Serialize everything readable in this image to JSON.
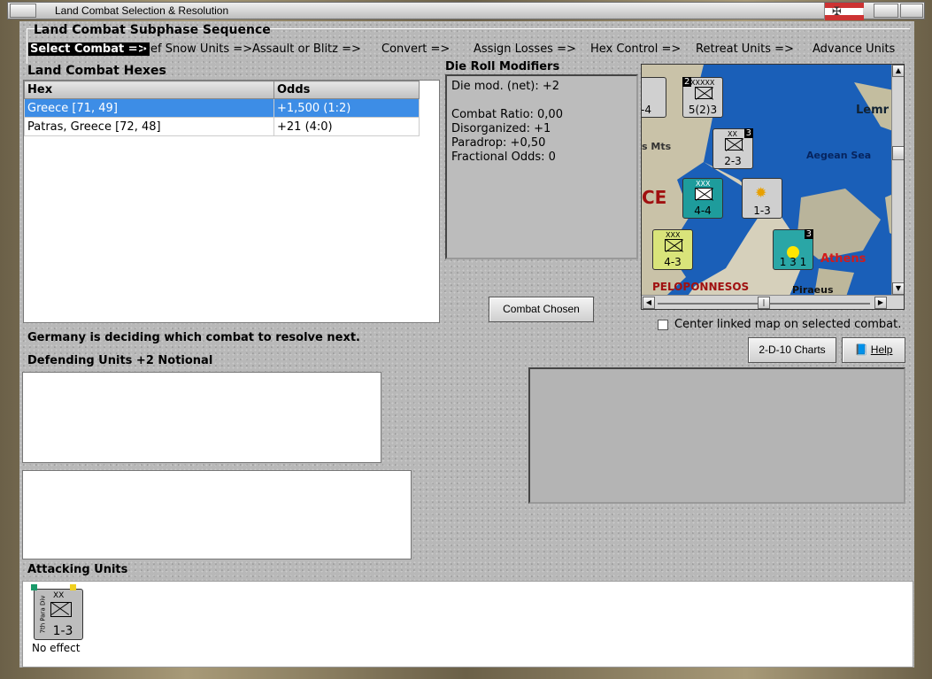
{
  "window": {
    "title": "Land Combat Selection & Resolution"
  },
  "sequence": {
    "title": "Land Combat Subphase Sequence",
    "items": [
      {
        "label": "Select Combat =>",
        "active": true
      },
      {
        "label": "Def Snow Units =>"
      },
      {
        "label": "Assault or Blitz =>"
      },
      {
        "label": "Convert =>"
      },
      {
        "label": "Assign Losses =>"
      },
      {
        "label": "Hex Control =>"
      },
      {
        "label": "Retreat Units =>"
      },
      {
        "label": "Advance Units"
      }
    ]
  },
  "hexes": {
    "title": "Land Combat Hexes",
    "columns": [
      "Hex",
      "Odds"
    ],
    "rows": [
      {
        "hex": "Greece [71, 49]",
        "odds": "+1,500 (1:2)",
        "selected": true
      },
      {
        "hex": "Patras, Greece [72, 48]",
        "odds": "+21 (4:0)"
      }
    ]
  },
  "modifiers": {
    "title": "Die Roll Modifiers",
    "net": "Die mod. (net): +2",
    "lines": [
      "Combat Ratio: 0,00",
      "Disorganized: +1",
      "Paradrop: +0,50",
      "Fractional Odds: 0"
    ]
  },
  "map": {
    "labels": {
      "lemnos": "Lemr",
      "aegean": "Aegean Sea",
      "mts": "s Mts",
      "ce": "CE",
      "athens": "Athens",
      "peloponnesos": "PELOPONNESOS",
      "piraeus": "Piraeus"
    },
    "counters": [
      {
        "strength": "-4"
      },
      {
        "strength": "5(2)3",
        "size": "XXXXX",
        "badge": "2"
      },
      {
        "strength": "2-3",
        "size": "XX",
        "badge": "3"
      },
      {
        "strength": "4-4",
        "size": "XXX"
      },
      {
        "strength": "1-3"
      },
      {
        "strength": "4-3",
        "size": "XXX"
      },
      {
        "strength": "1 3 1",
        "badge": "3"
      }
    ]
  },
  "combat_button": "Combat Chosen",
  "center_checkbox": {
    "label": "Center linked map on selected combat.",
    "checked": false
  },
  "status": "Germany is deciding which combat to resolve next.",
  "defending_title": "Defending Units +2 Notional",
  "charts_button": "2-D-10 Charts",
  "help_button": "Help",
  "attacking": {
    "title": "Attacking Units",
    "units": [
      {
        "label": "7th Para Div",
        "size": "XX",
        "strength": "1-3",
        "result": "No effect"
      }
    ]
  },
  "colors": {
    "selection": "#3d8de6",
    "sea": "#1a5fb8",
    "attacker": "#bdbdbd"
  }
}
